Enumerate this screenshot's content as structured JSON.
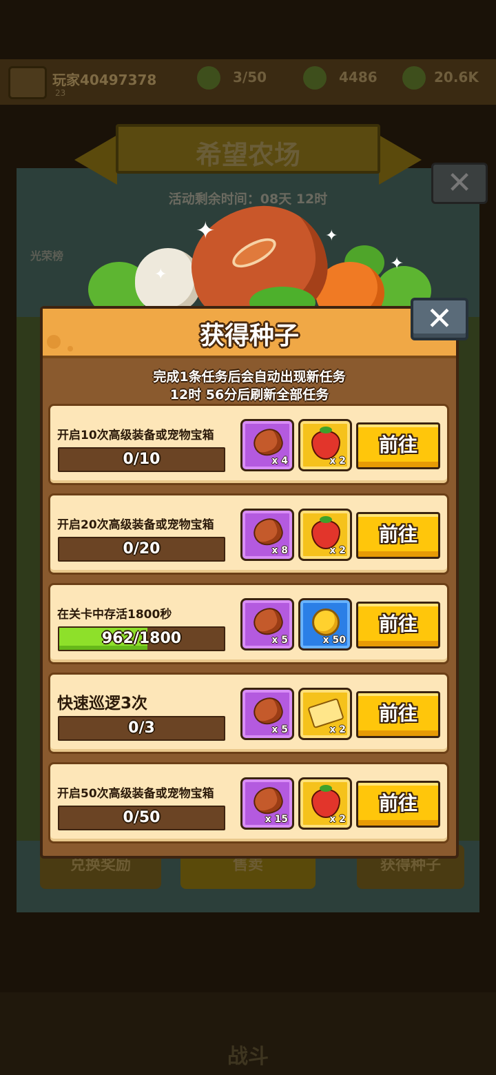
{
  "background": {
    "player_name": "玩家40497378",
    "player_level": "23",
    "resources": [
      "3/50",
      "4486",
      "20.6K"
    ],
    "farm_title": "希望农场",
    "event_timer": "活动剩余时间：08天 12时",
    "ranking_label": "光荣榜",
    "buttons": [
      "兑换奖励",
      "售卖",
      "获得种子"
    ],
    "battle_label": "战斗"
  },
  "modal": {
    "title": "获得种子",
    "notice_line1": "完成1条任务后会自动出现新任务",
    "notice_line2": "12时 56分后刷新全部任务",
    "close_icon": "close-x",
    "go_label": "前往",
    "tasks": [
      {
        "name": "开启10次高级装备或宠物宝箱",
        "progress_text": "0/10",
        "progress": 0.0,
        "rewards": [
          {
            "item": "bean",
            "qty": "x 4",
            "frame": "purple"
          },
          {
            "item": "strawberry",
            "qty": "x 2",
            "frame": "gold"
          }
        ]
      },
      {
        "name": "开启20次高级装备或宠物宝箱",
        "progress_text": "0/20",
        "progress": 0.0,
        "rewards": [
          {
            "item": "bean",
            "qty": "x 8",
            "frame": "purple"
          },
          {
            "item": "strawberry",
            "qty": "x 2",
            "frame": "gold"
          }
        ]
      },
      {
        "name": "在关卡中存活1800秒",
        "progress_text": "962/1800",
        "progress": 0.534,
        "rewards": [
          {
            "item": "bean",
            "qty": "x 5",
            "frame": "purple"
          },
          {
            "item": "coin",
            "qty": "x 50",
            "frame": "blue"
          }
        ]
      },
      {
        "name": "快速巡逻3次",
        "progress_text": "0/3",
        "progress": 0.0,
        "rewards": [
          {
            "item": "bean",
            "qty": "x 5",
            "frame": "purple"
          },
          {
            "item": "ticket",
            "qty": "x 2",
            "frame": "gold"
          }
        ]
      },
      {
        "name": "开启50次高级装备或宠物宝箱",
        "progress_text": "0/50",
        "progress": 0.0,
        "rewards": [
          {
            "item": "bean",
            "qty": "x 15",
            "frame": "purple"
          },
          {
            "item": "strawberry",
            "qty": "x 2",
            "frame": "gold"
          }
        ]
      }
    ]
  }
}
